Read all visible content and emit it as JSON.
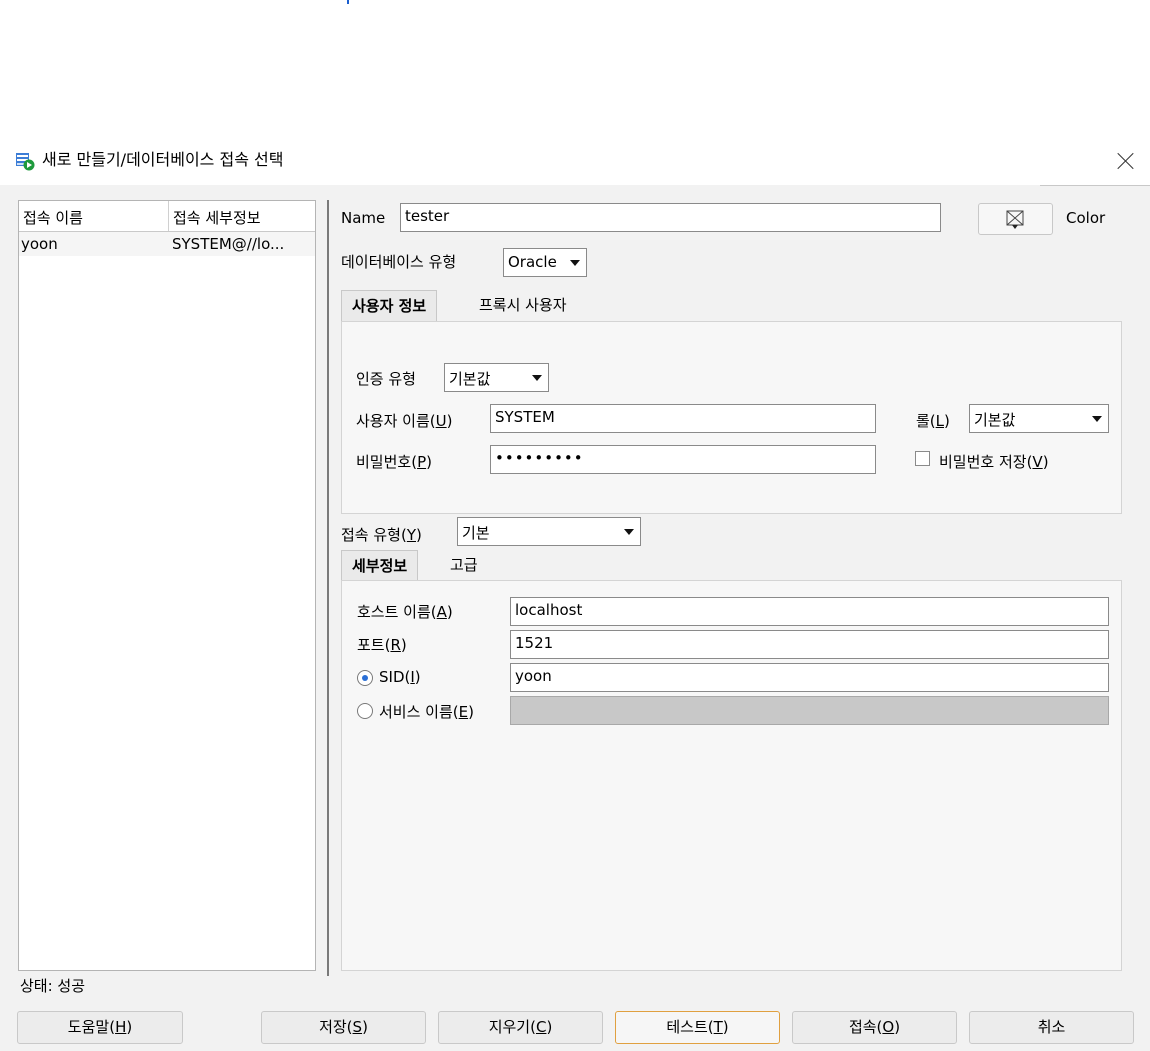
{
  "window": {
    "title": "새로 만들기/데이터베이스 접속 선택"
  },
  "connections": {
    "headers": [
      "접속 이름",
      "접속 세부정보"
    ],
    "rows": [
      {
        "name": "yoon",
        "details": "SYSTEM@//lo..."
      }
    ]
  },
  "status": "상태: 성공",
  "form": {
    "name_label": "Name",
    "name_value": "tester",
    "color_label": "Color",
    "db_type_label": "데이터베이스 유형",
    "db_type_value": "Oracle",
    "user_tabs": [
      "사용자 정보",
      "프록시 사용자"
    ],
    "auth_type_label": "인증 유형",
    "auth_type_value": "기본값",
    "username_label": "사용자 이름(",
    "username_mnemonic": "U",
    "username_value": "SYSTEM",
    "role_label": "롤(",
    "role_mnemonic": "L",
    "role_value": "기본값",
    "password_label": "비밀번호(",
    "password_mnemonic": "P",
    "password_value": "•••••••••",
    "save_password_label": "비밀번호 저장(",
    "save_password_mnemonic": "V",
    "save_password_checked": false,
    "conn_type_label": "접속 유형(",
    "conn_type_mnemonic": "Y",
    "conn_type_value": "기본",
    "detail_tabs": [
      "세부정보",
      "고급"
    ],
    "host_label": "호스트 이름(",
    "host_mnemonic": "A",
    "host_value": "localhost",
    "port_label": "포트(",
    "port_mnemonic": "R",
    "port_value": "1521",
    "sid_label": "SID(",
    "sid_mnemonic": "I",
    "sid_value": "yoon",
    "sid_selected": true,
    "service_label": "서비스 이름(",
    "service_mnemonic": "E",
    "service_value": ""
  },
  "buttons": {
    "help": {
      "label": "도움말(",
      "mnemonic": "H"
    },
    "save": {
      "label": "저장(",
      "mnemonic": "S"
    },
    "clear": {
      "label": "지우기(",
      "mnemonic": "C"
    },
    "test": {
      "label": "테스트(",
      "mnemonic": "T"
    },
    "connect": {
      "label": "접속(",
      "mnemonic": "O"
    },
    "cancel": {
      "label": "취소"
    }
  },
  "icons": {
    "window": "database-connect-icon",
    "close": "close-icon",
    "color": "color-picker-icon"
  }
}
